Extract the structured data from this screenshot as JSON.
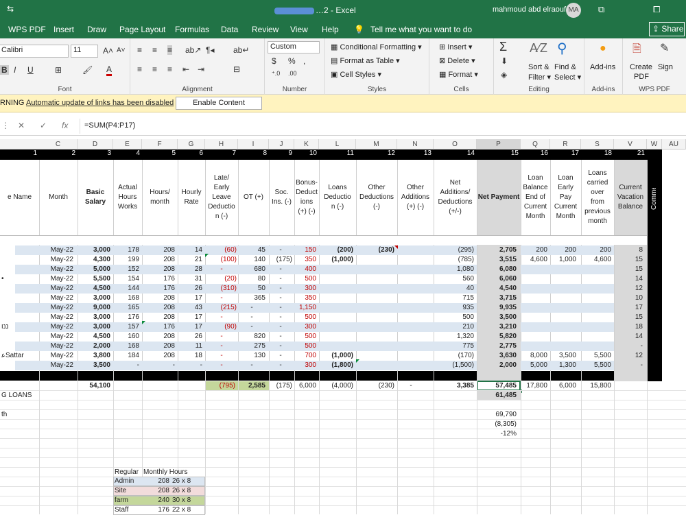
{
  "title_bar": {
    "quick_access": "⇆",
    "document_title": "…2 - Excel",
    "user": "mahmoud abd elraouf",
    "avatar": "MA",
    "win_btn1": "⧉",
    "win_btn2": "⧠",
    "win_btn3": "✕"
  },
  "tabs": [
    "WPS PDF",
    "Insert",
    "Draw",
    "Page Layout",
    "Formulas",
    "Data",
    "Review",
    "View",
    "Help"
  ],
  "tell_me": "Tell me what you want to do",
  "share": "Share",
  "ribbon": {
    "font_name": "Calibri",
    "font_size": "11",
    "font_group": "Font",
    "alignment_group": "Alignment",
    "number_format": "Custom",
    "number_group": "Number",
    "conditional_formatting": "Conditional Formatting",
    "format_as_table": "Format as Table",
    "cell_styles": "Cell Styles",
    "styles_group": "Styles",
    "insert": "Insert",
    "delete": "Delete",
    "format": "Format",
    "cells_group": "Cells",
    "sort_filter_1": "Sort &",
    "sort_filter_2": "Filter",
    "find_select_1": "Find &",
    "find_select_2": "Select",
    "editing_group": "Editing",
    "addins": "Add-ins",
    "addins_group": "Add-ins",
    "create_pdf_1": "Create",
    "create_pdf_2": "PDF",
    "sign": "Sign",
    "wps_group": "WPS PDF"
  },
  "warning": {
    "label": "RNING",
    "message": "Automatic update of links has been disabled",
    "button": "Enable Content"
  },
  "formula": "=SUM(P4:P17)",
  "columns": [
    "C",
    "D",
    "E",
    "F",
    "G",
    "H",
    "I",
    "J",
    "K",
    "L",
    "M",
    "N",
    "O",
    "P",
    "Q",
    "R",
    "S",
    "V",
    "W",
    "AU"
  ],
  "col_numbers": [
    "1",
    "2",
    "3",
    "4",
    "5",
    "6",
    "7",
    "8",
    "9",
    "10",
    "11",
    "12",
    "13",
    "14",
    "15",
    "16",
    "17",
    "18",
    "21"
  ],
  "headers": {
    "name": "e Name",
    "month": "Month",
    "basic": [
      "Basic",
      "Salary"
    ],
    "actual": [
      "Actual",
      "Hours",
      "Works"
    ],
    "hours_month": [
      "Hours/",
      "month"
    ],
    "hourly": [
      "Hourly",
      "Rate"
    ],
    "late": [
      "Late/",
      "Early",
      "Leave",
      "Deductio",
      "n (-)"
    ],
    "ot": "OT (+)",
    "soc": [
      "Soc.",
      "Ins. (-)"
    ],
    "bonus": [
      "Bonus-",
      "Deduct",
      "ions",
      "(+) (-)"
    ],
    "loans": [
      "Loans",
      "Deductio",
      "n (-)"
    ],
    "other_ded": [
      "Other",
      "Deductions",
      "(-)"
    ],
    "other_add": [
      "Other",
      "Additions",
      "(+) (-)"
    ],
    "net_add": [
      "Net",
      "Additions/",
      "Deductions",
      "(+/-)"
    ],
    "net_pay": "Net Payment",
    "loan_bal": [
      "Loan",
      "Balance",
      "End of",
      "Current",
      "Month"
    ],
    "loan_early": [
      "Loan",
      "Early",
      "Pay",
      "Current",
      "Month"
    ],
    "loans_carried": [
      "Loans",
      "carried",
      "over",
      "from",
      "previous",
      "month"
    ],
    "vacation": [
      "Current",
      "Vacation",
      "Balance"
    ],
    "comments": "Comments"
  },
  "rows": [
    {
      "name": "",
      "month": "May-22",
      "basic": "3,000",
      "actual": "178",
      "hm": "208",
      "rate": "14",
      "late": "(60)",
      "ot": "45",
      "soc": "-",
      "bonus": "150",
      "loans": "(200)",
      "oded": "(230)",
      "oadd": "",
      "net_add": "(295)",
      "net": "2,705",
      "lbal": "200",
      "learly": "200",
      "lcar": "200",
      "vac": "8"
    },
    {
      "name": "",
      "month": "May-22",
      "basic": "4,300",
      "actual": "199",
      "hm": "208",
      "rate": "21",
      "late": "(100)",
      "ot": "140",
      "soc": "(175)",
      "bonus": "350",
      "loans": "(1,000)",
      "oded": "",
      "oadd": "",
      "net_add": "(785)",
      "net": "3,515",
      "lbal": "4,600",
      "learly": "1,000",
      "lcar": "4,600",
      "vac": "15"
    },
    {
      "name": "",
      "month": "May-22",
      "basic": "5,000",
      "actual": "152",
      "hm": "208",
      "rate": "28",
      "late": "-",
      "ot": "680",
      "soc": "-",
      "bonus": "400",
      "loans": "",
      "oded": "",
      "oadd": "",
      "net_add": "1,080",
      "net": "6,080",
      "lbal": "",
      "learly": "",
      "lcar": "",
      "vac": "15"
    },
    {
      "name": "•",
      "month": "May-22",
      "basic": "5,500",
      "actual": "154",
      "hm": "176",
      "rate": "31",
      "late": "(20)",
      "ot": "80",
      "soc": "-",
      "bonus": "500",
      "loans": "",
      "oded": "",
      "oadd": "",
      "net_add": "560",
      "net": "6,060",
      "lbal": "",
      "learly": "",
      "lcar": "",
      "vac": "14"
    },
    {
      "name": "",
      "month": "May-22",
      "basic": "4,500",
      "actual": "144",
      "hm": "176",
      "rate": "26",
      "late": "(310)",
      "ot": "50",
      "soc": "-",
      "bonus": "300",
      "loans": "",
      "oded": "",
      "oadd": "",
      "net_add": "40",
      "net": "4,540",
      "lbal": "",
      "learly": "",
      "lcar": "",
      "vac": "12"
    },
    {
      "name": "",
      "month": "May-22",
      "basic": "3,000",
      "actual": "168",
      "hm": "208",
      "rate": "17",
      "late": "-",
      "ot": "365",
      "soc": "-",
      "bonus": "350",
      "loans": "",
      "oded": "",
      "oadd": "",
      "net_add": "715",
      "net": "3,715",
      "lbal": "",
      "learly": "",
      "lcar": "",
      "vac": "10"
    },
    {
      "name": "",
      "month": "May-22",
      "basic": "9,000",
      "actual": "165",
      "hm": "208",
      "rate": "43",
      "late": "(215)",
      "ot": "-",
      "soc": "-",
      "bonus": "1,150",
      "loans": "",
      "oded": "",
      "oadd": "",
      "net_add": "935",
      "net": "9,935",
      "lbal": "",
      "learly": "",
      "lcar": "",
      "vac": "17"
    },
    {
      "name": "",
      "month": "May-22",
      "basic": "3,000",
      "actual": "176",
      "hm": "208",
      "rate": "17",
      "late": "-",
      "ot": "-",
      "soc": "-",
      "bonus": "500",
      "loans": "",
      "oded": "",
      "oadd": "",
      "net_add": "500",
      "net": "3,500",
      "lbal": "",
      "learly": "",
      "lcar": "",
      "vac": "15"
    },
    {
      "name": "ננו",
      "month": "May-22",
      "basic": "3,000",
      "actual": "157",
      "hm": "176",
      "rate": "17",
      "late": "(90)",
      "ot": "-",
      "soc": "-",
      "bonus": "300",
      "loans": "",
      "oded": "",
      "oadd": "",
      "net_add": "210",
      "net": "3,210",
      "lbal": "",
      "learly": "",
      "lcar": "",
      "vac": "18"
    },
    {
      "name": "",
      "month": "May-22",
      "basic": "4,500",
      "actual": "160",
      "hm": "208",
      "rate": "26",
      "late": "-",
      "ot": "820",
      "soc": "-",
      "bonus": "500",
      "loans": "",
      "oded": "",
      "oadd": "",
      "net_add": "1,320",
      "net": "5,820",
      "lbal": "",
      "learly": "",
      "lcar": "",
      "vac": "14"
    },
    {
      "name": "",
      "month": "May-22",
      "basic": "2,000",
      "actual": "168",
      "hm": "208",
      "rate": "11",
      "late": "-",
      "ot": "275",
      "soc": "-",
      "bonus": "500",
      "loans": "",
      "oded": "",
      "oadd": "",
      "net_add": "775",
      "net": "2,775",
      "lbal": "",
      "learly": "",
      "lcar": "",
      "vac": "-"
    },
    {
      "name": "ﻋSattar",
      "month": "May-22",
      "basic": "3,800",
      "actual": "184",
      "hm": "208",
      "rate": "18",
      "late": "-",
      "ot": "130",
      "soc": "-",
      "bonus": "700",
      "loans": "(1,000)",
      "oded": "",
      "oadd": "",
      "net_add": "(170)",
      "net": "3,630",
      "lbal": "8,000",
      "learly": "3,500",
      "lcar": "5,500",
      "vac": "12"
    },
    {
      "name": "",
      "month": "May-22",
      "basic": "3,500",
      "actual": "-",
      "hm": "-",
      "rate": "-",
      "late": "-",
      "ot": "-",
      "soc": "-",
      "bonus": "300",
      "loans": "(1,800)",
      "oded": "",
      "oadd": "",
      "net_add": "(1,500)",
      "net": "2,000",
      "lbal": "5,000",
      "learly": "1,300",
      "lcar": "5,500",
      "vac": "-"
    }
  ],
  "totals": {
    "basic": "54,100",
    "late": "(795)",
    "ot": "2,585",
    "soc": "(175)",
    "bonus": "6,000",
    "loans": "(4,000)",
    "oded": "(230)",
    "oadd": "-",
    "net_add": "3,385",
    "net": "57,485",
    "lbal": "17,800",
    "learly": "6,000",
    "lcar": "15,800"
  },
  "extra": {
    "g_loans": "G LOANS",
    "g_loans_val": "61,485",
    "th": "th",
    "v1": "69,790",
    "v2": "(8,305)",
    "v3": "-12%"
  },
  "hours_table": {
    "h1": "Regular",
    "h2": "Monthly Hours",
    "rows": [
      {
        "label": "Admin",
        "hours": "208",
        "calc": "26 x 8",
        "color": "#dce6f1"
      },
      {
        "label": "Site",
        "hours": "208",
        "calc": "26 x 8",
        "color": "#f2dcdb"
      },
      {
        "label": "farm",
        "hours": "240",
        "calc": "30 x 8",
        "color": "#c4d79b"
      },
      {
        "label": "Staff",
        "hours": "176",
        "calc": "22 x 8",
        "color": "#ffffff"
      }
    ]
  }
}
